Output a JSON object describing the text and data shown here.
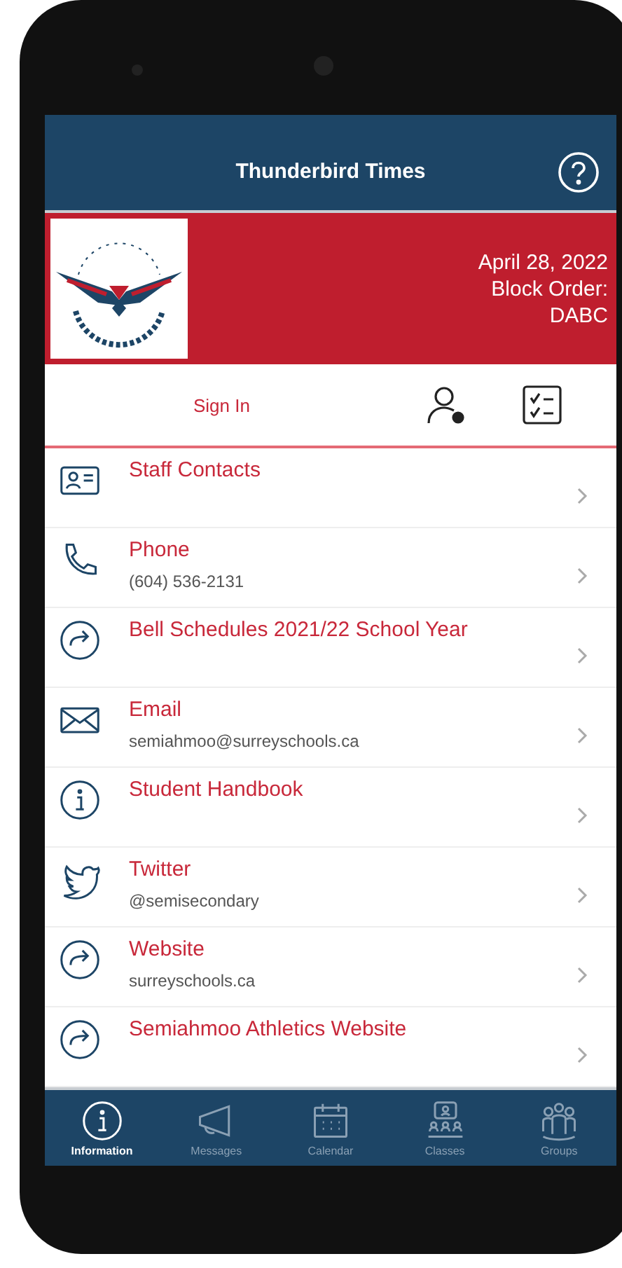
{
  "app_bar": {
    "title": "Thunderbird Times"
  },
  "banner": {
    "lines": [
      "April 28, 2022",
      "Block Order:",
      "DABC"
    ]
  },
  "account_row": {
    "sign_in": "Sign In"
  },
  "items": [
    {
      "kind": "contacts",
      "title": "Staff Contacts"
    },
    {
      "kind": "phone",
      "title": "Phone",
      "subtitle": "(604) 536-2131"
    },
    {
      "kind": "link",
      "title": "Bell Schedules 2021/22 School Year"
    },
    {
      "kind": "email",
      "title": "Email",
      "subtitle": "semiahmoo@surreyschools.ca"
    },
    {
      "kind": "info",
      "title": "Student Handbook"
    },
    {
      "kind": "twitter",
      "title": "Twitter",
      "subtitle": "@semisecondary"
    },
    {
      "kind": "link",
      "title": "Website",
      "subtitle": "surreyschools.ca"
    },
    {
      "kind": "link",
      "title": "Semiahmoo Athletics Website"
    }
  ],
  "tabs": [
    {
      "kind": "info",
      "label": "Information",
      "selected": true
    },
    {
      "kind": "messages",
      "label": "Messages",
      "selected": false
    },
    {
      "kind": "calendar",
      "label": "Calendar",
      "selected": false
    },
    {
      "kind": "classes",
      "label": "Classes",
      "selected": false
    },
    {
      "kind": "groups",
      "label": "Groups",
      "selected": false
    }
  ]
}
